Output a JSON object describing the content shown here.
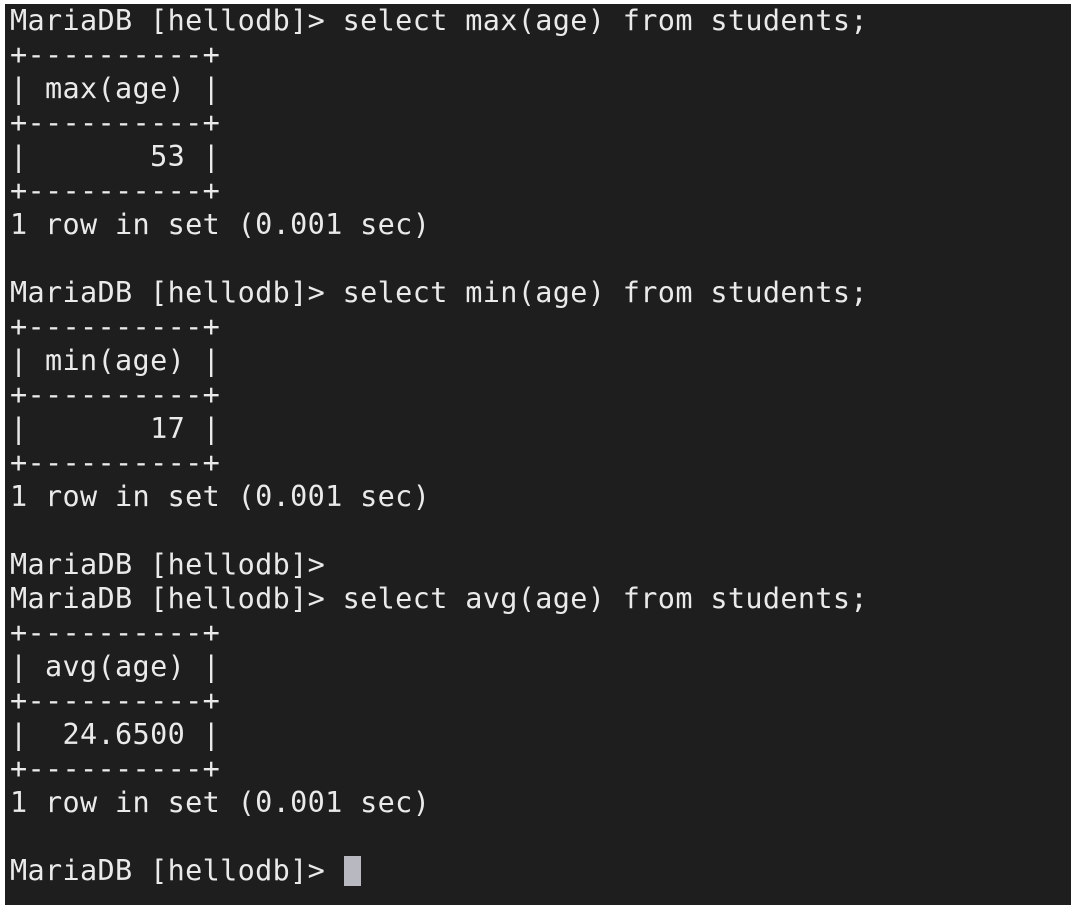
{
  "terminal": {
    "blocks": [
      {
        "prompt": "MariaDB [hellodb]> select max(age) from students;",
        "border": "+----------+",
        "header": "| max(age) |",
        "row": "|       53 |",
        "summary": "1 row in set (0.001 sec)"
      },
      {
        "prompt": "MariaDB [hellodb]> select min(age) from students;",
        "border": "+----------+",
        "header": "| min(age) |",
        "row": "|       17 |",
        "summary": "1 row in set (0.001 sec)"
      },
      {
        "prompt": "MariaDB [hellodb]> select avg(age) from students;",
        "border": "+----------+",
        "header": "| avg(age) |",
        "row": "|  24.6500 |",
        "summary": "1 row in set (0.001 sec)"
      }
    ],
    "empty_prompt": "MariaDB [hellodb]>",
    "final_prompt": "MariaDB [hellodb]> ",
    "colors": {
      "background": "#1e1e1e",
      "text": "#eaeaea",
      "cursor": "#b8b8c0"
    }
  }
}
